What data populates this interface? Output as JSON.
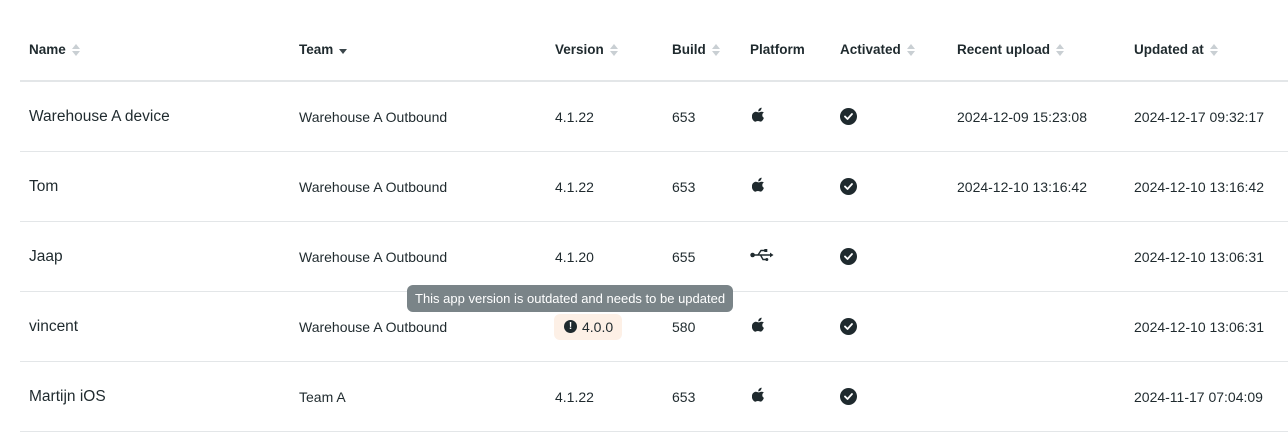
{
  "columns": {
    "name": "Name",
    "team": "Team",
    "version": "Version",
    "build": "Build",
    "platform": "Platform",
    "activated": "Activated",
    "recent_upload": "Recent upload",
    "updated_at": "Updated at"
  },
  "rows": [
    {
      "name": "Warehouse A device",
      "team": "Warehouse A Outbound",
      "version": "4.1.22",
      "build": "653",
      "platform": "apple-icon",
      "activated": true,
      "recent_upload": "2024-12-09 15:23:08",
      "updated_at": "2024-12-17 09:32:17"
    },
    {
      "name": "Tom",
      "team": "Warehouse A Outbound",
      "version": "4.1.22",
      "build": "653",
      "platform": "apple-icon",
      "activated": true,
      "recent_upload": "2024-12-10 13:16:42",
      "updated_at": "2024-12-10 13:16:42"
    },
    {
      "name": "Jaap",
      "team": "Warehouse A Outbound",
      "version": "4.1.20",
      "build": "655",
      "platform": "usb-icon",
      "activated": true,
      "recent_upload": "",
      "updated_at": "2024-12-10 13:06:31"
    },
    {
      "name": "vincent",
      "team": "Warehouse A Outbound",
      "version": "4.0.0",
      "version_outdated": true,
      "build": "580",
      "platform": "apple-icon",
      "activated": true,
      "recent_upload": "",
      "updated_at": "2024-12-10 13:06:31"
    },
    {
      "name": "Martijn iOS",
      "team": "Team A",
      "version": "4.1.22",
      "build": "653",
      "platform": "apple-icon",
      "activated": true,
      "recent_upload": "",
      "updated_at": "2024-11-17 07:04:09"
    }
  ],
  "tooltip": {
    "text": "This app version is outdated and needs to be updated"
  },
  "colors": {
    "text": "#1f2a2e",
    "badge_bg": "#fdf0e6",
    "tooltip_bg": "#7a8488",
    "divider": "#e3e6e8"
  }
}
